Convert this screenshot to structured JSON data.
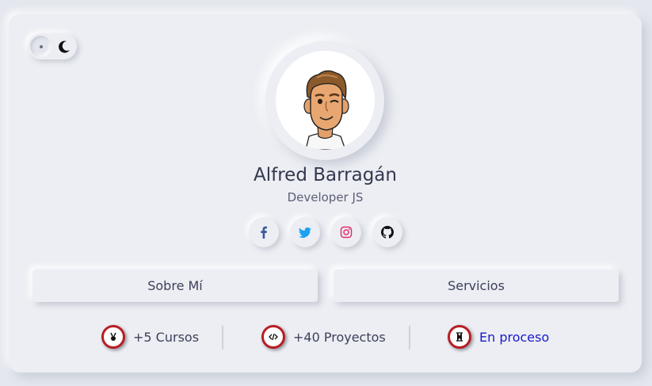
{
  "profile": {
    "name": "Alfred Barragán",
    "role": "Developer JS"
  },
  "theme_toggle": {
    "state": "light",
    "icons": [
      "dot-icon",
      "moon-icon"
    ]
  },
  "social": [
    {
      "name": "facebook-icon",
      "color": "#3b5998"
    },
    {
      "name": "twitter-icon",
      "color": "#1da1f2"
    },
    {
      "name": "instagram-icon",
      "color": "#e1306c"
    },
    {
      "name": "github-icon",
      "color": "#111111"
    }
  ],
  "buttons": {
    "about": "Sobre Mí",
    "services": "Servicios"
  },
  "stats": [
    {
      "label": "+5 Cursos",
      "icon": "medal-icon"
    },
    {
      "label": "+40 Proyectos",
      "icon": "code-icon"
    },
    {
      "label": "En proceso",
      "icon": "hourglass-icon"
    }
  ],
  "colors": {
    "badge_border": "#b91d22",
    "link": "#1a1acc"
  }
}
